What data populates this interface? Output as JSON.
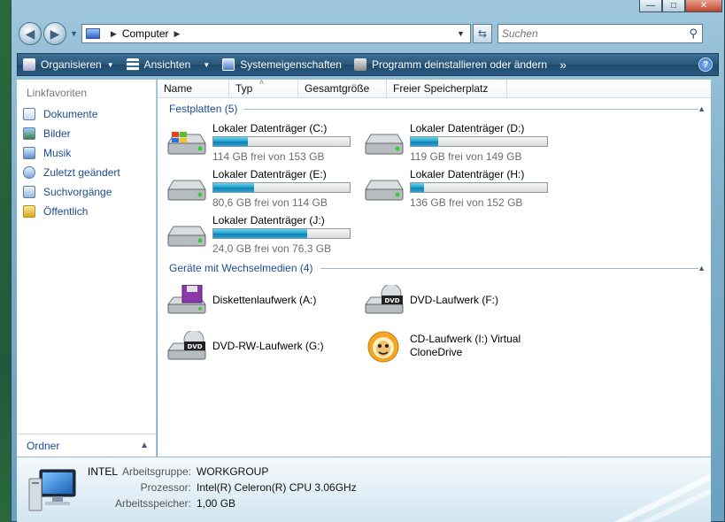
{
  "window": {
    "caption": {
      "minimize": "—",
      "maximize": "□",
      "close": "✕"
    }
  },
  "address": {
    "back_icon": "back-arrow-icon",
    "forward_icon": "forward-arrow-icon",
    "location": "Computer",
    "refresh_icon": "refresh-icon",
    "search_placeholder": "Suchen"
  },
  "toolbar": {
    "organize": "Organisieren",
    "views": "Ansichten",
    "system_properties": "Systemeigenschaften",
    "uninstall": "Programm deinstallieren oder ändern",
    "more": "»",
    "help": "?"
  },
  "sidebar": {
    "title": "Linkfavoriten",
    "items": [
      {
        "label": "Dokumente",
        "icon": "documents-icon"
      },
      {
        "label": "Bilder",
        "icon": "pictures-icon"
      },
      {
        "label": "Musik",
        "icon": "music-icon"
      },
      {
        "label": "Zuletzt geändert",
        "icon": "recent-icon"
      },
      {
        "label": "Suchvorgänge",
        "icon": "searches-icon"
      },
      {
        "label": "Öffentlich",
        "icon": "public-folder-icon"
      }
    ],
    "folders_label": "Ordner"
  },
  "columns": [
    "Name",
    "Typ",
    "Gesamtgröße",
    "Freier Speicherplatz"
  ],
  "groups": {
    "hard_disks": "Festplatten (5)",
    "removable": "Geräte mit Wechselmedien (4)"
  },
  "drives": [
    {
      "name": "Lokaler Datenträger (C:)",
      "free": "114 GB frei von 153 GB",
      "used_fraction": 0.25,
      "icon": "system-drive-icon"
    },
    {
      "name": "Lokaler Datenträger (D:)",
      "free": "119 GB frei von 149 GB",
      "used_fraction": 0.2,
      "icon": "hard-drive-icon"
    },
    {
      "name": "Lokaler Datenträger (E:)",
      "free": "80,6 GB frei von 114 GB",
      "used_fraction": 0.3,
      "icon": "hard-drive-icon"
    },
    {
      "name": "Lokaler Datenträger (H:)",
      "free": "136 GB frei von 152 GB",
      "used_fraction": 0.1,
      "icon": "hard-drive-icon"
    },
    {
      "name": "Lokaler Datenträger (J:)",
      "free": "24,0 GB frei von 76,3 GB",
      "used_fraction": 0.69,
      "icon": "hard-drive-icon"
    }
  ],
  "removable": [
    {
      "name": "Diskettenlaufwerk (A:)",
      "icon": "floppy-drive-icon"
    },
    {
      "name": "DVD-Laufwerk (F:)",
      "icon": "dvd-drive-icon"
    },
    {
      "name": "DVD-RW-Laufwerk (G:)",
      "icon": "dvd-rw-drive-icon"
    },
    {
      "name": "CD-Laufwerk (I:) Virtual",
      "name2": "CloneDrive",
      "icon": "clonedrive-sheep-icon"
    }
  ],
  "details": {
    "computer_name": "INTEL",
    "rows": [
      {
        "label": "Arbeitsgruppe:",
        "value": "WORKGROUP"
      },
      {
        "label": "Prozessor:",
        "value": "Intel(R) Celeron(R) CPU 3.06GHz"
      },
      {
        "label": "Arbeitsspeicher:",
        "value": "1,00 GB"
      }
    ]
  }
}
